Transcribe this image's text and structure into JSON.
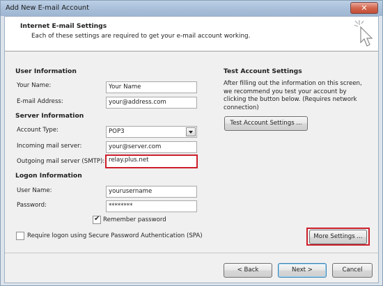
{
  "window": {
    "title": "Add New E-mail Account",
    "close_glyph": "✕"
  },
  "header": {
    "title": "Internet E-mail Settings",
    "subtitle": "Each of these settings are required to get your e-mail account working."
  },
  "user_info": {
    "heading": "User Information",
    "name_label": "Your Name:",
    "name_value": "Your Name",
    "email_label": "E-mail Address:",
    "email_value": "your@address.com"
  },
  "server_info": {
    "heading": "Server Information",
    "account_type_label": "Account Type:",
    "account_type_value": "POP3",
    "incoming_label": "Incoming mail server:",
    "incoming_value": "your@server.com",
    "outgoing_label": "Outgoing mail server (SMTP):",
    "outgoing_value": "relay.plus.net"
  },
  "logon_info": {
    "heading": "Logon Information",
    "username_label": "User Name:",
    "username_value": "yourusername",
    "password_label": "Password:",
    "password_value": "********",
    "remember_label": "Remember password",
    "remember_checked": true,
    "spa_label": "Require logon using Secure Password Authentication (SPA)",
    "spa_checked": false
  },
  "test_settings": {
    "heading": "Test Account Settings",
    "description": "After filling out the information on this screen, we recommend you test your account by clicking the button below. (Requires network connection)",
    "button_label": "Test Account Settings ..."
  },
  "buttons": {
    "more_settings": "More Settings ...",
    "back": "< Back",
    "next": "Next >",
    "cancel": "Cancel"
  },
  "colors": {
    "highlight": "#cc1f2a",
    "window_frame": "#a9bfd9"
  },
  "icons": {
    "header_graphic": "pointer-sparkle-icon",
    "dropdown": "chevron-down-icon"
  }
}
